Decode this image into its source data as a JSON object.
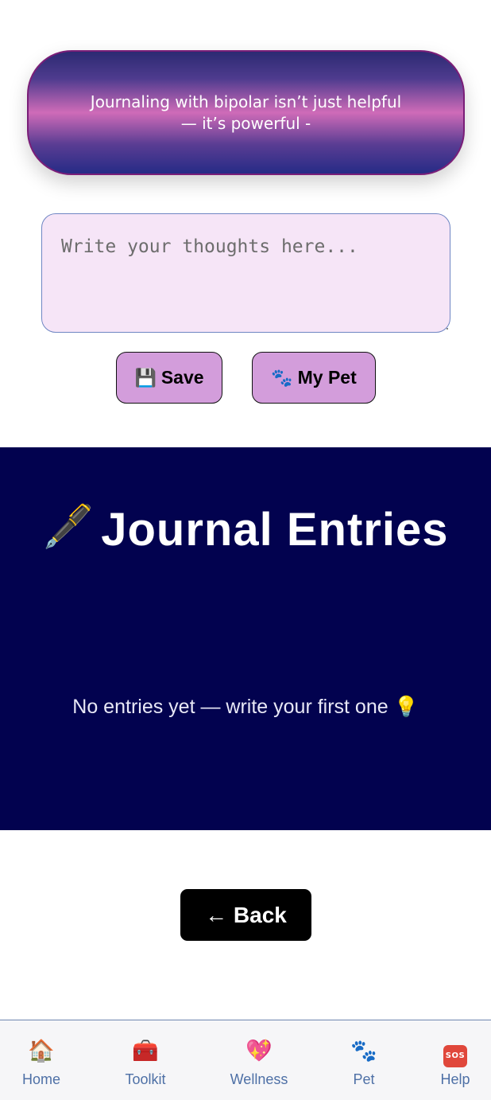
{
  "banner": {
    "text": "Journaling with bipolar isn’t just helpful — it’s powerful -"
  },
  "journal": {
    "placeholder": "Write your thoughts here...",
    "value": ""
  },
  "actions": {
    "save_icon": "💾",
    "save_label": "Save",
    "pet_icon": "🐾",
    "pet_label": "My Pet"
  },
  "entries": {
    "title_icon": "🖋️",
    "title": "Journal Entries",
    "empty_message": "No entries yet — write your first one 💡"
  },
  "back": {
    "label": "← Back"
  },
  "nav": {
    "items": [
      {
        "label": "Home",
        "icon": "🏠"
      },
      {
        "label": "Toolkit",
        "icon": "🧰"
      },
      {
        "label": "Wellness",
        "icon": "💖"
      },
      {
        "label": "Pet",
        "icon": "🐾"
      },
      {
        "label": "Help",
        "icon": "SOS"
      }
    ]
  },
  "colors": {
    "banner_border": "#7a1e78",
    "input_bg": "#f6e5f7",
    "button_bg": "#d39ddb",
    "entries_bg": "#02024f",
    "nav_label": "#4e70a6"
  }
}
